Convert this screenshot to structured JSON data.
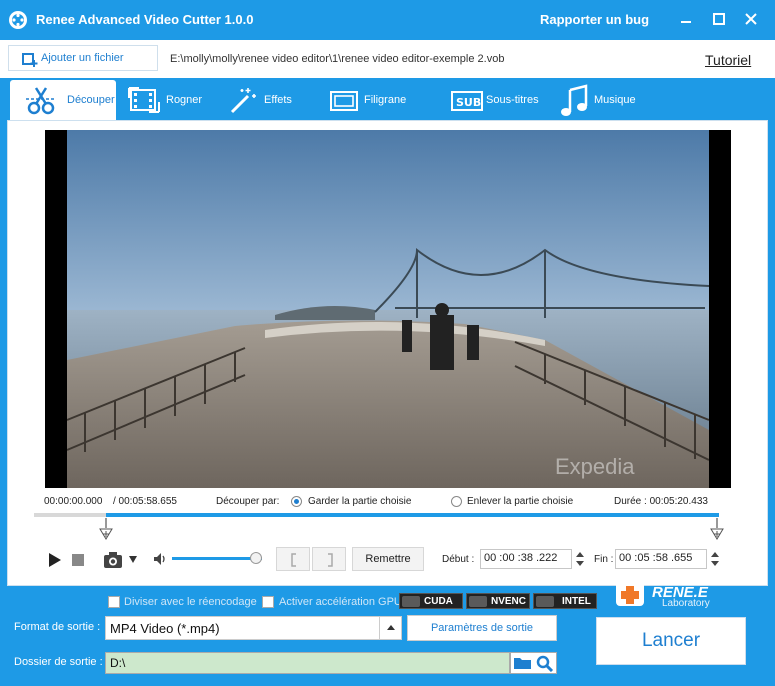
{
  "window": {
    "title": "Renee Advanced Video Cutter 1.0.0",
    "bug_link": "Rapporter un bug"
  },
  "file": {
    "add_label": "Ajouter un fichier",
    "path": "E:\\molly\\molly\\renee video editor\\1\\renee video editor-exemple 2.vob",
    "tutorial": "Tutoriel"
  },
  "tabs": [
    {
      "label": "Découper",
      "icon": "scissors-icon",
      "active": true
    },
    {
      "label": "Rogner",
      "icon": "film-crop-icon"
    },
    {
      "label": "Effets",
      "icon": "magic-wand-icon"
    },
    {
      "label": "Filigrane",
      "icon": "watermark-icon"
    },
    {
      "label": "Sous-titres",
      "icon": "subtitle-icon"
    },
    {
      "label": "Musique",
      "icon": "music-note-icon"
    }
  ],
  "video": {
    "watermark_text": "Expedia"
  },
  "cut": {
    "current_time": "00:00:00.000",
    "total_time": "/ 00:05:58.655",
    "cut_by_label": "Découper par:",
    "option_keep": "Garder la partie choisie",
    "option_remove": "Enlever la partie choisie",
    "duration": "Durée : 00:05:20.433",
    "reset_label": "Remettre",
    "start_label": "Début :",
    "start_value": "00 :00 :38 .222",
    "end_label": "Fin :",
    "end_value": "00 :05 :58 .655"
  },
  "options": {
    "split_reencode": "Diviser avec le réencodage",
    "gpu_accel": "Activer accélération GPU",
    "badges": [
      "CUDA",
      "NVENC",
      "INTEL"
    ]
  },
  "output": {
    "format_label": "Format de sortie :",
    "format_value": "MP4 Video (*.mp4)",
    "params_label": "Paramètres de sortie",
    "folder_label": "Dossier de sortie :",
    "folder_value": "D:\\",
    "launch_label": "Lancer"
  },
  "brand": {
    "name": "RENE.E",
    "sub": "Laboratory"
  },
  "colors": {
    "accent": "#1e9ae6",
    "link": "#1e7fd0",
    "folder_field": "#cde8cc"
  }
}
